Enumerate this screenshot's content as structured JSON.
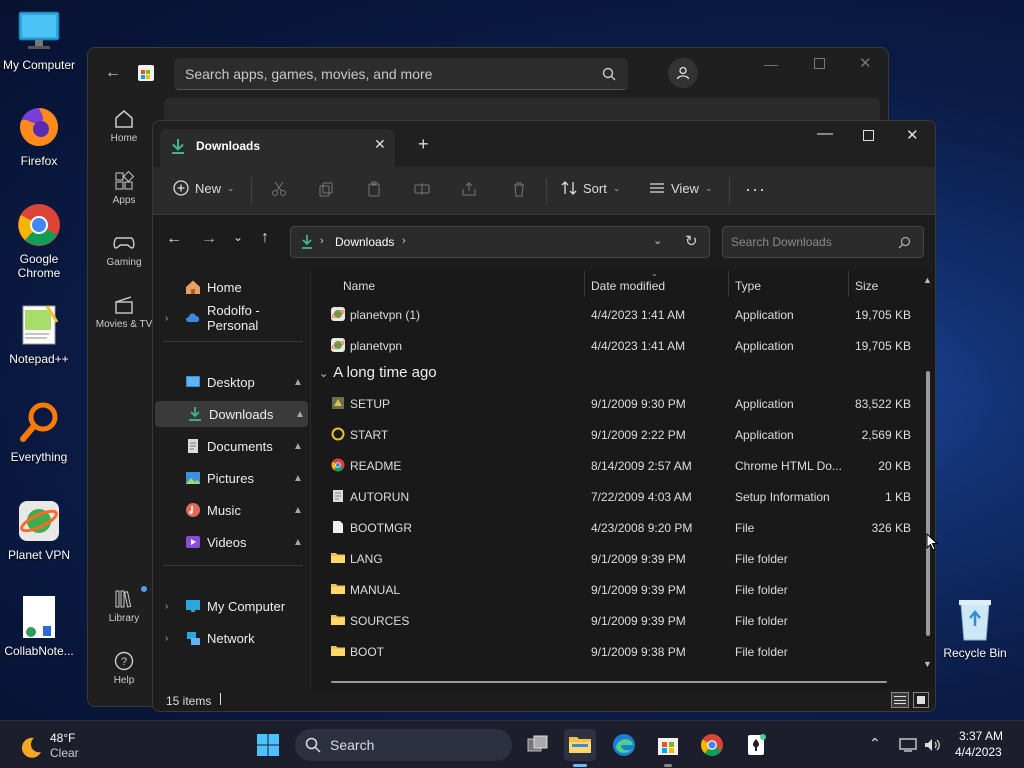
{
  "desktop": {
    "icons": [
      {
        "label": "My Computer",
        "icon": "monitor-icon"
      },
      {
        "label": "Firefox",
        "icon": "firefox-icon"
      },
      {
        "label": "Google Chrome",
        "icon": "chrome-icon"
      },
      {
        "label": "Notepad++",
        "icon": "notepadpp-icon"
      },
      {
        "label": "Everything",
        "icon": "magnifier-icon"
      },
      {
        "label": "Planet VPN",
        "icon": "planet-vpn-icon"
      },
      {
        "label": "CollabNote...",
        "icon": "document-icon"
      },
      {
        "label": "Recycle Bin",
        "icon": "recycle-bin-icon"
      }
    ]
  },
  "store": {
    "search_placeholder": "Search apps, games, movies, and more",
    "nav": [
      {
        "label": "Home"
      },
      {
        "label": "Apps"
      },
      {
        "label": "Gaming"
      },
      {
        "label": "Movies & TV"
      },
      {
        "label": "Library"
      },
      {
        "label": "Help"
      }
    ]
  },
  "explorer": {
    "tab_title": "Downloads",
    "toolbar": {
      "new_label": "New",
      "sort_label": "Sort",
      "view_label": "View"
    },
    "address": {
      "crumb": "Downloads",
      "search_placeholder": "Search Downloads"
    },
    "nav": {
      "home": "Home",
      "onedrive": "Rodolfo - Personal",
      "desktop": "Desktop",
      "downloads": "Downloads",
      "documents": "Documents",
      "pictures": "Pictures",
      "music": "Music",
      "videos": "Videos",
      "my_computer": "My Computer",
      "network": "Network"
    },
    "columns": {
      "name": "Name",
      "date": "Date modified",
      "type": "Type",
      "size": "Size"
    },
    "group_label": "A long time ago",
    "files_top": [
      {
        "name": "planetvpn (1)",
        "date": "4/4/2023 1:41 AM",
        "type": "Application",
        "size": "19,705 KB"
      },
      {
        "name": "planetvpn",
        "date": "4/4/2023 1:41 AM",
        "type": "Application",
        "size": "19,705 KB"
      }
    ],
    "files_old": [
      {
        "name": "SETUP",
        "date": "9/1/2009 9:30 PM",
        "type": "Application",
        "size": "83,522 KB"
      },
      {
        "name": "START",
        "date": "9/1/2009 2:22 PM",
        "type": "Application",
        "size": "2,569 KB"
      },
      {
        "name": "README",
        "date": "8/14/2009 2:57 AM",
        "type": "Chrome HTML Do...",
        "size": "20 KB"
      },
      {
        "name": "AUTORUN",
        "date": "7/22/2009 4:03 AM",
        "type": "Setup Information",
        "size": "1 KB"
      },
      {
        "name": "BOOTMGR",
        "date": "4/23/2008 9:20 PM",
        "type": "File",
        "size": "326 KB"
      },
      {
        "name": "LANG",
        "date": "9/1/2009 9:39 PM",
        "type": "File folder",
        "size": ""
      },
      {
        "name": "MANUAL",
        "date": "9/1/2009 9:39 PM",
        "type": "File folder",
        "size": ""
      },
      {
        "name": "SOURCES",
        "date": "9/1/2009 9:39 PM",
        "type": "File folder",
        "size": ""
      },
      {
        "name": "BOOT",
        "date": "9/1/2009 9:38 PM",
        "type": "File folder",
        "size": ""
      }
    ],
    "status": "15 items"
  },
  "taskbar": {
    "weather_temp": "48°F",
    "weather_desc": "Clear",
    "search_label": "Search",
    "time": "3:37 AM",
    "date": "4/4/2023"
  }
}
